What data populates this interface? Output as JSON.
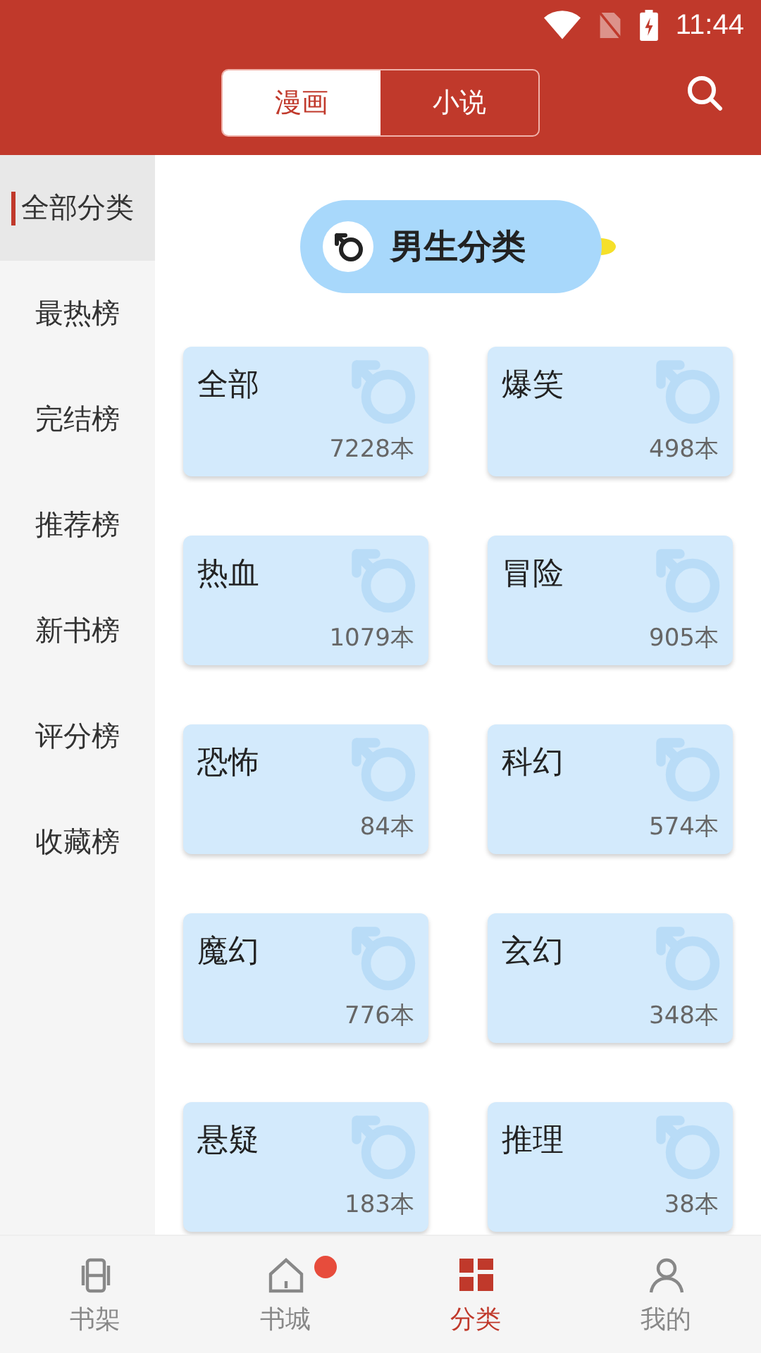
{
  "status_bar": {
    "time": "11:44"
  },
  "top_tabs": [
    {
      "label": "漫画",
      "selected": true
    },
    {
      "label": "小说",
      "selected": false
    }
  ],
  "sidebar": {
    "items": [
      {
        "label": "全部分类",
        "selected": true
      },
      {
        "label": "最热榜",
        "selected": false
      },
      {
        "label": "完结榜",
        "selected": false
      },
      {
        "label": "推荐榜",
        "selected": false
      },
      {
        "label": "新书榜",
        "selected": false
      },
      {
        "label": "评分榜",
        "selected": false
      },
      {
        "label": "收藏榜",
        "selected": false
      }
    ]
  },
  "section": {
    "title": "男生分类"
  },
  "categories": [
    {
      "name": "全部",
      "count": "7228本"
    },
    {
      "name": "爆笑",
      "count": "498本"
    },
    {
      "name": "热血",
      "count": "1079本"
    },
    {
      "name": "冒险",
      "count": "905本"
    },
    {
      "name": "恐怖",
      "count": "84本"
    },
    {
      "name": "科幻",
      "count": "574本"
    },
    {
      "name": "魔幻",
      "count": "776本"
    },
    {
      "name": "玄幻",
      "count": "348本"
    },
    {
      "name": "悬疑",
      "count": "183本"
    },
    {
      "name": "推理",
      "count": "38本"
    }
  ],
  "bottom_nav": [
    {
      "label": "书架",
      "kind": "shelf",
      "selected": false,
      "badge": false
    },
    {
      "label": "书城",
      "kind": "home",
      "selected": false,
      "badge": true
    },
    {
      "label": "分类",
      "kind": "grid",
      "selected": true,
      "badge": false
    },
    {
      "label": "我的",
      "kind": "user",
      "selected": false,
      "badge": false
    }
  ]
}
